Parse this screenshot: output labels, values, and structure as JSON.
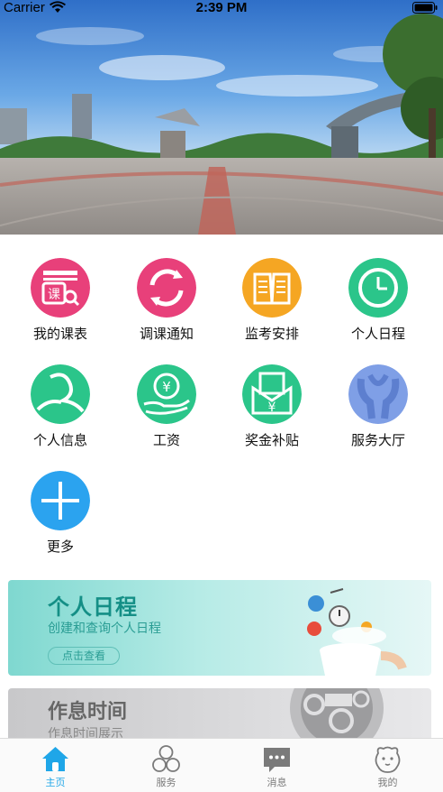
{
  "status_bar": {
    "carrier": "Carrier",
    "time": "2:39 PM"
  },
  "hero": {
    "image": "campus-plaza-panorama-with-jet-monument"
  },
  "menu": [
    {
      "label": "我的课表",
      "icon": "schedule-icon",
      "color": "#e8407a"
    },
    {
      "label": "调课通知",
      "icon": "refresh-icon",
      "color": "#e8407a"
    },
    {
      "label": "监考安排",
      "icon": "book-icon",
      "color": "#f5a623"
    },
    {
      "label": "个人日程",
      "icon": "clock-icon",
      "color": "#2bc58a"
    },
    {
      "label": "个人信息",
      "icon": "person-icon",
      "color": "#2bc58a"
    },
    {
      "label": "工资",
      "icon": "yuan-hand-icon",
      "color": "#2bc58a"
    },
    {
      "label": "奖金补贴",
      "icon": "yuan-envelope-icon",
      "color": "#2bc58a"
    },
    {
      "label": "服务大厅",
      "icon": "service-icon",
      "color": "#7f9fe6"
    },
    {
      "label": "更多",
      "icon": "plus-icon",
      "color": "#2ba3ef"
    }
  ],
  "banners": [
    {
      "title": "个人日程",
      "subtitle": "创建和查询个人日程",
      "button": "点击查看"
    },
    {
      "title": "作息时间",
      "subtitle": "作息时间展示"
    }
  ],
  "tabs": [
    {
      "label": "主页",
      "icon": "home-icon",
      "active": true
    },
    {
      "label": "服务",
      "icon": "services-icon",
      "active": false
    },
    {
      "label": "消息",
      "icon": "message-icon",
      "active": false
    },
    {
      "label": "我的",
      "icon": "profile-icon",
      "active": false
    }
  ],
  "colors": {
    "accent": "#1fa6e8",
    "tab_inactive": "#7a7a7a"
  }
}
